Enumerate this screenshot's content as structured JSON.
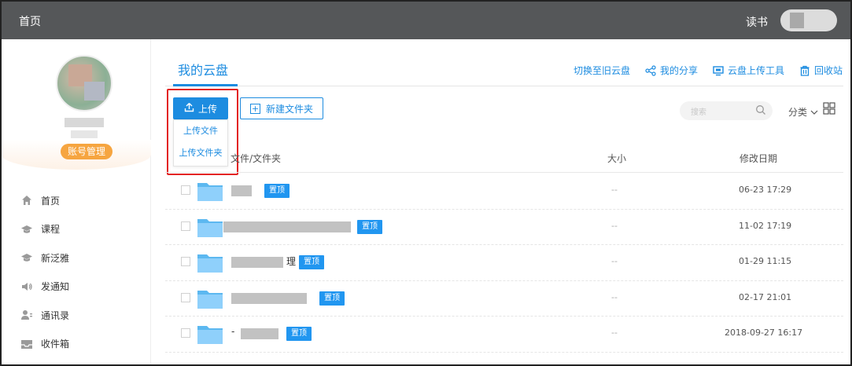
{
  "topbar": {
    "home": "首页",
    "reading": "读书"
  },
  "sidebar": {
    "account_button": "账号管理",
    "nav": [
      {
        "label": "首页",
        "icon": "home-icon"
      },
      {
        "label": "课程",
        "icon": "course-icon"
      },
      {
        "label": "新泛雅",
        "icon": "fanya-icon"
      },
      {
        "label": "发通知",
        "icon": "megaphone-icon"
      },
      {
        "label": "通讯录",
        "icon": "contacts-icon"
      },
      {
        "label": "收件箱",
        "icon": "inbox-icon"
      }
    ]
  },
  "main": {
    "tab_title": "我的云盘",
    "links": {
      "switch_old": "切换至旧云盘",
      "my_share": "我的分享",
      "upload_tool": "云盘上传工具",
      "recycle": "回收站"
    },
    "upload_button": "上传",
    "new_folder_button": "新建文件夹",
    "upload_menu": [
      "上传文件",
      "上传文件夹"
    ],
    "search_placeholder": "搜索",
    "sort_label": "分类",
    "columns": {
      "name": "文件/文件夹",
      "size": "大小",
      "date": "修改日期"
    },
    "rows": [
      {
        "name_suffix": "",
        "pin": "置顶",
        "size": "--",
        "date": "06-23 17:29"
      },
      {
        "name_suffix": "",
        "pin": "置顶",
        "size": "--",
        "date": "11-02 17:19"
      },
      {
        "name_suffix": "理",
        "pin": "置顶",
        "size": "--",
        "date": "01-29 11:15"
      },
      {
        "name_suffix": "",
        "pin": "置顶",
        "size": "--",
        "date": "02-17 21:01"
      },
      {
        "name_suffix": "-",
        "pin": "置顶",
        "size": "--",
        "date": "2018-09-27 16:17"
      }
    ]
  },
  "colors": {
    "accent": "#1d8ce0",
    "orange": "#f6a540",
    "topbar": "#555759",
    "highlight": "#e32424"
  }
}
